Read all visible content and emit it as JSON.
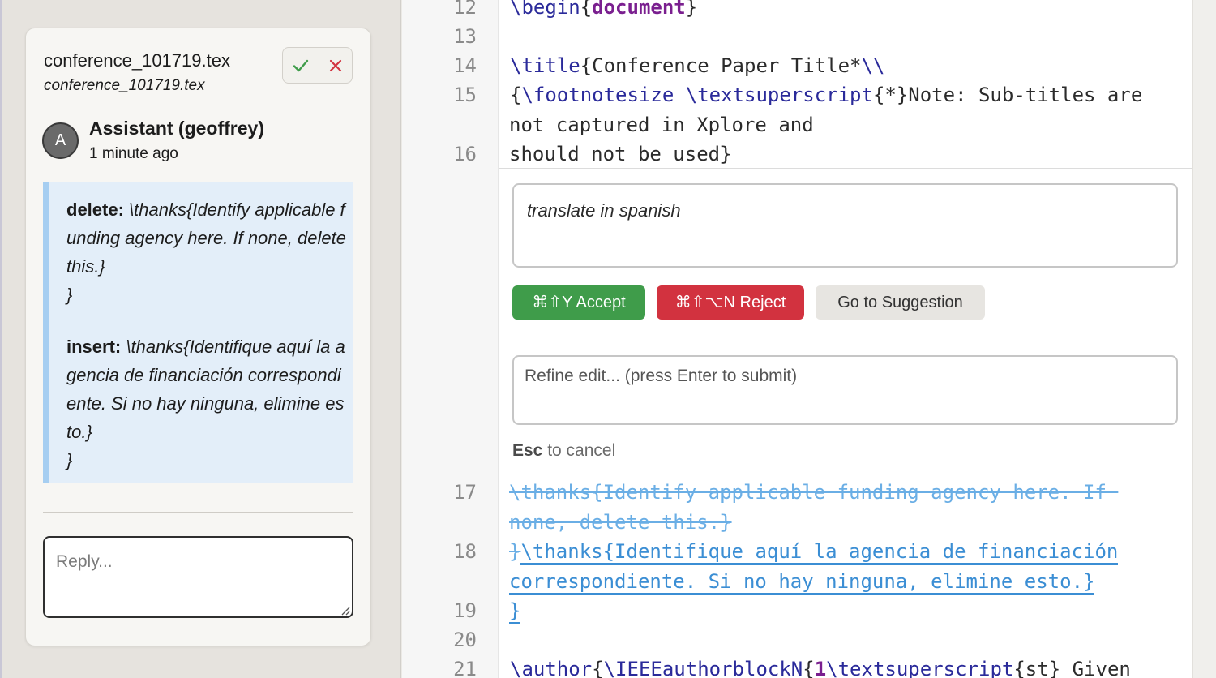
{
  "comment": {
    "title": "conference_101719.tex",
    "subtitle": "conference_101719.tex",
    "avatar_initial": "A",
    "author": "Assistant (geoffrey)",
    "time": "1 minute ago",
    "delete_label": "delete:",
    "delete_text": "\\thanks{Identify applicable funding agency here. If none, delete this.}",
    "delete_close": "}",
    "insert_label": "insert:",
    "insert_text": "\\thanks{Identifique aquí la agencia de financiación correspondiente. Si no hay ninguna, elimine esto.}",
    "insert_close": "}",
    "reply_placeholder": "Reply..."
  },
  "editor": {
    "line_numbers": [
      "12",
      "13",
      "14",
      "15",
      "16",
      "17",
      "18",
      "19",
      "20",
      "21"
    ],
    "lines": {
      "l12": {
        "cmd": "\\begin",
        "open": "{",
        "kw": "document",
        "close": "}"
      },
      "l14": {
        "cmd": "\\title",
        "text": "{Conference Paper Title*",
        "cmd2": "\\\\"
      },
      "l15a": {
        "open": "{",
        "cmd": "\\footnotesize",
        "sp": " ",
        "cmd2": "\\textsuperscript",
        "text": "{*}Note: Sub-titles are"
      },
      "l15b": "not captured in Xplore and",
      "l16": "should not be used}",
      "l17a": "\\thanks{Identify applicable funding agency here. If ",
      "l17b": "none, delete this.}",
      "l18_del": "}",
      "l18a": "\\thanks{Identifique aquí la agencia de financiación",
      "l18b": "correspondiente. Si no hay ninguna, elimine esto.}",
      "l19": "}",
      "l21": {
        "cmd": "\\author",
        "open": "{",
        "cmd2": "\\IEEEauthorblockN",
        "open2": "{",
        "num": "1",
        "cmd3": "\\textsuperscript",
        "text": "{st} Given"
      }
    }
  },
  "review_widget": {
    "prompt": "translate in spanish",
    "accept_label": "⌘⇧Y Accept",
    "reject_label": "⌘⇧⌥N Reject",
    "goto_label": "Go to Suggestion",
    "refine_placeholder": "Refine edit... (press Enter to submit)",
    "esc_key": "Esc",
    "esc_text": " to cancel"
  },
  "colors": {
    "accept": "#3f9c4a",
    "reject": "#d2323f",
    "deleted_text": "#6aaee5",
    "inserted_text": "#3b8ed4",
    "change_box_bg": "#e3eef9"
  },
  "icons": [
    "check-icon",
    "x-icon",
    "resize-grip-icon"
  ]
}
